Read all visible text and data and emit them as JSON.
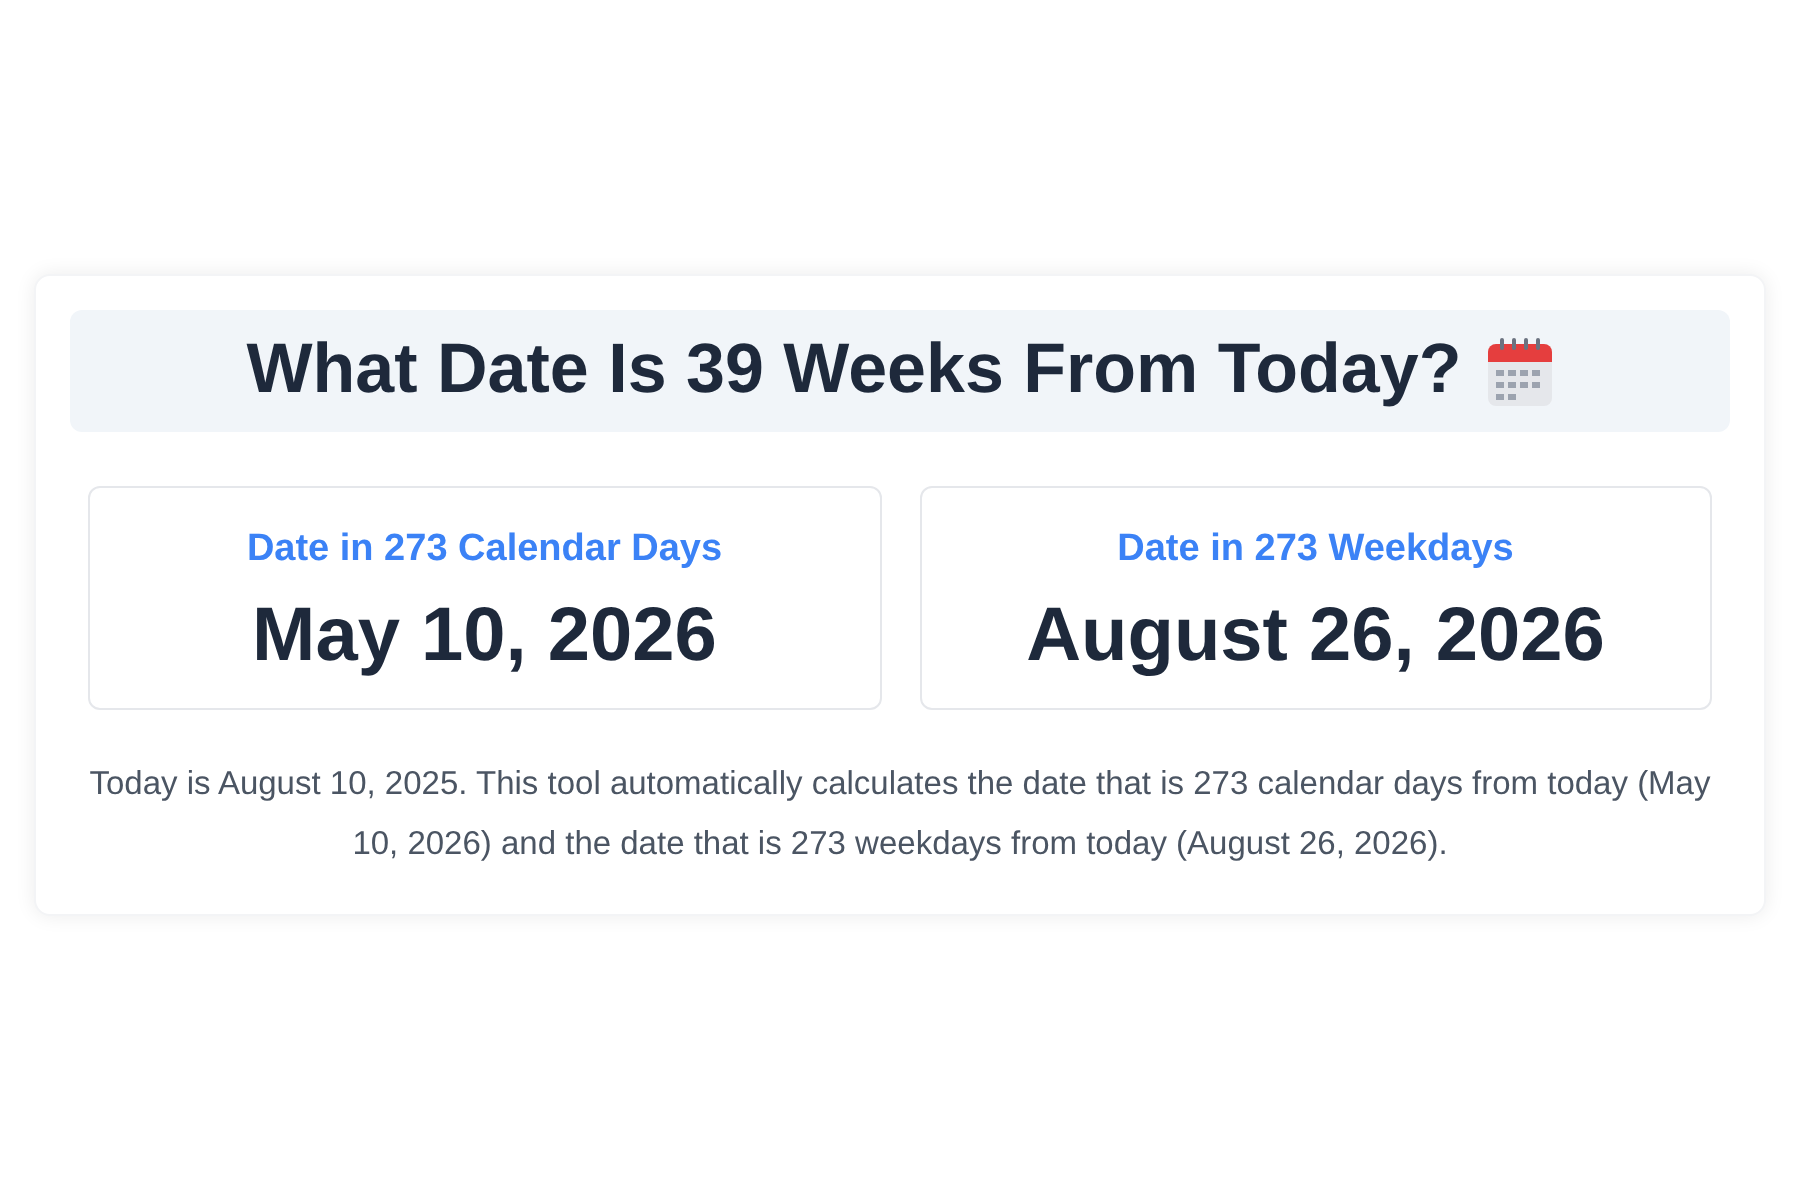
{
  "title": "What Date Is 39 Weeks From Today?",
  "results": [
    {
      "label": "Date in 273 Calendar Days",
      "value": "May 10, 2026"
    },
    {
      "label": "Date in 273 Weekdays",
      "value": "August 26, 2026"
    }
  ],
  "description": "Today is August 10, 2025. This tool automatically calculates the date that is 273 calendar days from today (May 10, 2026) and the date that is 273 weekdays from today (August 26, 2026)."
}
